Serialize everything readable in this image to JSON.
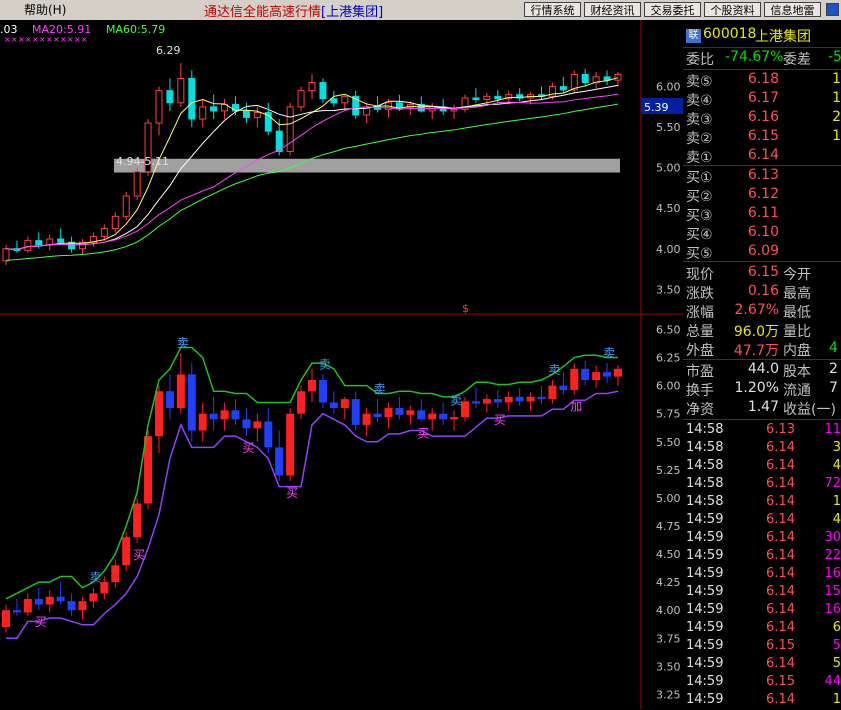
{
  "menubar": {
    "help": "帮助(H)",
    "app_title": "通达信全能高速行情",
    "stock_bracket": "[上港集团]",
    "buttons": [
      "行情系统",
      "财经资讯",
      "交易委托",
      "个股资料",
      "信息地雷"
    ]
  },
  "legend": {
    "ma10": ".03",
    "ma20": "MA20:5.91",
    "ma60": "MA60:5.79",
    "ma10_color": "#ffffff",
    "ma20_color": "#ff40ff",
    "ma60_color": "#40ff40"
  },
  "annotations": {
    "high_label": "6.29",
    "range_label": "4.94-5.11",
    "price_marker": "5.39",
    "dollar_marker": "$",
    "signal_sell": "卖",
    "signal_buy": "买",
    "signal_add": "加"
  },
  "sidebar": {
    "badge": "联",
    "code": "600018",
    "name": "上港集团",
    "weibi_label": "委比",
    "weibi_value": "-74.67%",
    "weicha_label": "委差",
    "weicha_value": "-5",
    "asks": [
      {
        "label": "卖⑤",
        "price": "6.18",
        "vol": "1"
      },
      {
        "label": "卖④",
        "price": "6.17",
        "vol": "1"
      },
      {
        "label": "卖③",
        "price": "6.16",
        "vol": "2"
      },
      {
        "label": "卖②",
        "price": "6.15",
        "vol": "1"
      },
      {
        "label": "卖①",
        "price": "6.14",
        "vol": ""
      }
    ],
    "bids": [
      {
        "label": "买①",
        "price": "6.13",
        "vol": ""
      },
      {
        "label": "买②",
        "price": "6.12",
        "vol": ""
      },
      {
        "label": "买③",
        "price": "6.11",
        "vol": ""
      },
      {
        "label": "买④",
        "price": "6.10",
        "vol": ""
      },
      {
        "label": "买⑤",
        "price": "6.09",
        "vol": ""
      }
    ],
    "quote": [
      {
        "l1": "现价",
        "v1": "6.15",
        "c1": "red",
        "l2": "今开"
      },
      {
        "l1": "涨跌",
        "v1": "0.16",
        "c1": "red",
        "l2": "最高"
      },
      {
        "l1": "涨幅",
        "v1": "2.67%",
        "c1": "red",
        "l2": "最低"
      },
      {
        "l1": "总量",
        "v1": "96.0万",
        "c1": "yel",
        "l2": "量比"
      },
      {
        "l1": "外盘",
        "v1": "47.7万",
        "c1": "red",
        "l2": "内盘",
        "v2": "4",
        "c2": "grn"
      }
    ],
    "fund": [
      {
        "l1": "市盈",
        "v1": "44.0",
        "l2": "股本",
        "v2": "2"
      },
      {
        "l1": "换手",
        "v1": "1.20%",
        "l2": "流通",
        "v2": "7"
      },
      {
        "l1": "净资",
        "v1": "1.47",
        "l2": "收益(一)",
        "v2": ""
      }
    ],
    "ticks": [
      {
        "t": "14:58",
        "p": "6.13",
        "v": "11",
        "c": "mag"
      },
      {
        "t": "14:58",
        "p": "6.14",
        "v": "3",
        "c": "yel"
      },
      {
        "t": "14:58",
        "p": "6.14",
        "v": "4",
        "c": "yel"
      },
      {
        "t": "14:58",
        "p": "6.14",
        "v": "72",
        "c": "mag"
      },
      {
        "t": "14:58",
        "p": "6.14",
        "v": "1",
        "c": "yel"
      },
      {
        "t": "14:59",
        "p": "6.14",
        "v": "4",
        "c": "yel"
      },
      {
        "t": "14:59",
        "p": "6.14",
        "v": "30",
        "c": "mag"
      },
      {
        "t": "14:59",
        "p": "6.14",
        "v": "22",
        "c": "mag"
      },
      {
        "t": "14:59",
        "p": "6.14",
        "v": "16",
        "c": "mag"
      },
      {
        "t": "14:59",
        "p": "6.14",
        "v": "15",
        "c": "mag"
      },
      {
        "t": "14:59",
        "p": "6.14",
        "v": "16",
        "c": "mag"
      },
      {
        "t": "14:59",
        "p": "6.14",
        "v": "6",
        "c": "yel"
      },
      {
        "t": "14:59",
        "p": "6.15",
        "v": "5",
        "c": "mag"
      },
      {
        "t": "14:59",
        "p": "6.14",
        "v": "5",
        "c": "yel"
      },
      {
        "t": "14:59",
        "p": "6.15",
        "v": "44",
        "c": "mag"
      },
      {
        "t": "14:59",
        "p": "6.14",
        "v": "1",
        "c": "yel"
      }
    ]
  },
  "chart_data": [
    {
      "type": "candlestick",
      "name": "",
      "yticks": [
        3.5,
        4.0,
        4.5,
        5.0,
        5.5,
        6.0
      ],
      "ylim": [
        3.22,
        6.55
      ],
      "band": [
        4.94,
        5.11
      ],
      "ohlc": [
        [
          3.85,
          4.05,
          3.8,
          4.0
        ],
        [
          4.0,
          4.1,
          3.95,
          3.98
        ],
        [
          3.98,
          4.15,
          3.95,
          4.1
        ],
        [
          4.1,
          4.2,
          4.0,
          4.05
        ],
        [
          4.05,
          4.18,
          3.98,
          4.12
        ],
        [
          4.12,
          4.25,
          4.05,
          4.08
        ],
        [
          4.08,
          4.15,
          3.95,
          4.0
        ],
        [
          4.0,
          4.12,
          3.92,
          4.08
        ],
        [
          4.08,
          4.2,
          4.02,
          4.15
        ],
        [
          4.15,
          4.3,
          4.1,
          4.25
        ],
        [
          4.25,
          4.45,
          4.2,
          4.4
        ],
        [
          4.4,
          4.7,
          4.35,
          4.65
        ],
        [
          4.65,
          5.0,
          4.6,
          4.95
        ],
        [
          4.95,
          5.6,
          4.9,
          5.55
        ],
        [
          5.55,
          6.0,
          5.4,
          5.95
        ],
        [
          5.95,
          6.1,
          5.7,
          5.8
        ],
        [
          5.8,
          6.29,
          5.75,
          6.1
        ],
        [
          6.1,
          6.2,
          5.5,
          5.6
        ],
        [
          5.6,
          5.85,
          5.5,
          5.75
        ],
        [
          5.75,
          5.9,
          5.6,
          5.7
        ],
        [
          5.7,
          5.85,
          5.6,
          5.78
        ],
        [
          5.78,
          5.88,
          5.65,
          5.7
        ],
        [
          5.7,
          5.8,
          5.55,
          5.62
        ],
        [
          5.62,
          5.75,
          5.5,
          5.68
        ],
        [
          5.68,
          5.8,
          5.4,
          5.45
        ],
        [
          5.45,
          5.6,
          5.15,
          5.2
        ],
        [
          5.2,
          5.8,
          5.15,
          5.75
        ],
        [
          5.75,
          6.0,
          5.7,
          5.95
        ],
        [
          5.95,
          6.15,
          5.85,
          6.05
        ],
        [
          6.05,
          6.1,
          5.8,
          5.85
        ],
        [
          5.85,
          5.95,
          5.75,
          5.8
        ],
        [
          5.8,
          5.9,
          5.7,
          5.88
        ],
        [
          5.88,
          5.95,
          5.6,
          5.65
        ],
        [
          5.65,
          5.8,
          5.55,
          5.75
        ],
        [
          5.75,
          5.88,
          5.68,
          5.72
        ],
        [
          5.72,
          5.85,
          5.62,
          5.8
        ],
        [
          5.8,
          5.9,
          5.7,
          5.74
        ],
        [
          5.74,
          5.82,
          5.65,
          5.78
        ],
        [
          5.78,
          5.88,
          5.68,
          5.7
        ],
        [
          5.7,
          5.8,
          5.6,
          5.75
        ],
        [
          5.75,
          5.85,
          5.65,
          5.7
        ],
        [
          5.7,
          5.78,
          5.6,
          5.72
        ],
        [
          5.72,
          5.9,
          5.68,
          5.86
        ],
        [
          5.86,
          5.98,
          5.8,
          5.84
        ],
        [
          5.84,
          5.92,
          5.76,
          5.88
        ],
        [
          5.88,
          5.96,
          5.8,
          5.85
        ],
        [
          5.85,
          5.95,
          5.78,
          5.9
        ],
        [
          5.9,
          5.98,
          5.82,
          5.86
        ],
        [
          5.86,
          5.94,
          5.78,
          5.9
        ],
        [
          5.9,
          6.0,
          5.84,
          5.88
        ],
        [
          5.88,
          6.05,
          5.84,
          6.0
        ],
        [
          6.0,
          6.12,
          5.92,
          5.96
        ],
        [
          5.96,
          6.2,
          5.92,
          6.15
        ],
        [
          6.15,
          6.22,
          6.0,
          6.05
        ],
        [
          6.05,
          6.18,
          5.98,
          6.12
        ],
        [
          6.12,
          6.2,
          6.02,
          6.08
        ],
        [
          6.08,
          6.18,
          6.0,
          6.15
        ]
      ],
      "ma20_last": 5.91,
      "ma60_last": 5.79
    },
    {
      "type": "bar",
      "name": "",
      "yticks": [
        3.25,
        3.5,
        3.75,
        4.0,
        4.25,
        4.5,
        4.75,
        5.0,
        5.25,
        5.5,
        5.75,
        6.0,
        6.25,
        6.5
      ],
      "ylim": [
        3.12,
        6.62
      ]
    }
  ]
}
